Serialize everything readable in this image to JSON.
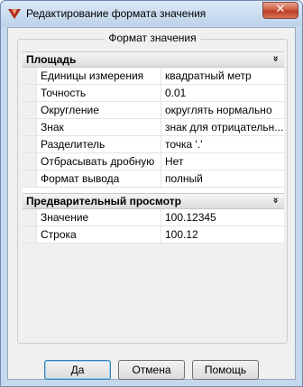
{
  "window": {
    "title": "Редактирование формата значения",
    "close_symbol": "✕"
  },
  "group": {
    "legend": "Формат значения"
  },
  "categories": [
    {
      "title": "Площадь",
      "rows": [
        {
          "name": "Единицы измерения",
          "value": "квадратный метр"
        },
        {
          "name": "Точность",
          "value": "0.01"
        },
        {
          "name": "Округление",
          "value": "округлять нормально"
        },
        {
          "name": "Знак",
          "value": "знак для отрицательн..."
        },
        {
          "name": "Разделитель",
          "value": "точка '.'"
        },
        {
          "name": "Отбрасывать дробную",
          "value": "Нет"
        },
        {
          "name": "Формат вывода",
          "value": "полный"
        }
      ]
    },
    {
      "title": "Предварительный просмотр",
      "rows": [
        {
          "name": "Значение",
          "value": "100.12345"
        },
        {
          "name": "Строка",
          "value": "100.12"
        }
      ]
    }
  ],
  "collapse_glyph": "»",
  "buttons": {
    "ok": "Да",
    "cancel": "Отмена",
    "help": "Помощь"
  },
  "colors": {
    "window_frame": "#c5d8ec",
    "close_button": "#c9553a",
    "default_button_border": "#3c7fb1"
  }
}
